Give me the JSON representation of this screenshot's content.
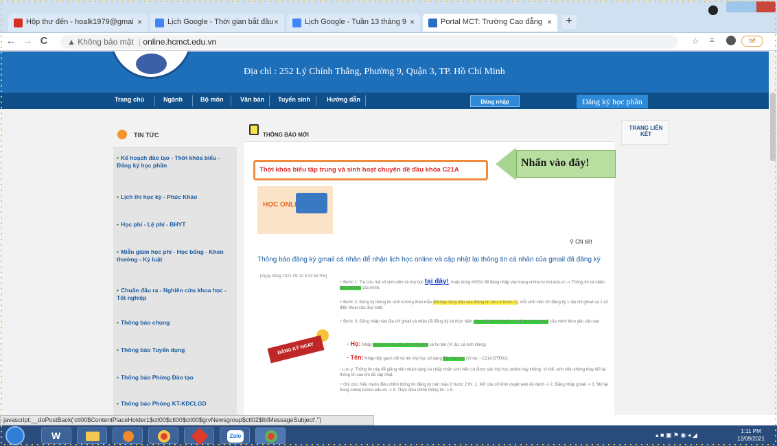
{
  "browser": {
    "tabs": [
      {
        "label": "Hộp thư đến - hoalk1979@gmai",
        "icon": "gmail-icon",
        "color": "#d93025"
      },
      {
        "label": "Lịch Google - Thời gian bắt đầu",
        "icon": "calendar-icon",
        "color": "#4285f4"
      },
      {
        "label": "Lịch Google - Tuần 13 tháng 9",
        "icon": "calendar-icon",
        "color": "#4285f4"
      },
      {
        "label": "Portal MCT: Trường Cao đẳng",
        "icon": "portal-icon",
        "color": "#2b6cc4"
      }
    ],
    "close_glyph": "×",
    "new_tab_glyph": "+",
    "back_glyph": "←",
    "forward_glyph": "→",
    "reload_glyph": "C",
    "security_text": "▲ Không bảo mật",
    "url": "online.hcmct.edu.vn",
    "profile_label": "tiế"
  },
  "site": {
    "address": "Địa chỉ : 252 Lý Chính Thắng, Phường 9, Quận 3, TP. Hồ Chí Minh",
    "menu": [
      "Trang chủ",
      "Ngành",
      "Bộ môn",
      "Văn bản",
      "Tuyển sinh",
      "Hướng dẫn"
    ],
    "login_label": "Đăng nhập",
    "register_label": "Đăng ký học phần"
  },
  "sidebar": {
    "title": "TIN TỨC",
    "items": [
      "Kế hoạch đào tạo - Thời khóa biểu - Đăng ký học phần",
      "Lịch thi học kỳ - Phúc Khảo",
      "Học phí - Lệ phí - BHYT",
      "Miễn giảm học phí - Học bổng - Khen thưởng - Kỷ luật",
      "Chuẩn đầu ra - Nghiên cứu khoa học - Tốt nghiệp",
      "Thông báo chung",
      "Thông báo Tuyển dụng",
      "Thông báo Phòng Đào tạo",
      "Thông báo Phòng KT-KĐCLGD"
    ]
  },
  "main": {
    "title": "THÔNG BÁO MỚI",
    "highlight": "Thời khóa biểu tập trung và sinh hoạt chuyên đề đầu khóa C21A",
    "callout": "Nhấn vào đây!",
    "image_text": "HỌC ONLINE",
    "detail_label": "CN tiết",
    "notice_title": "Thông báo đăng ký gmail cá nhân để nhận lịch học online và cập nhật lại thông tin cá nhân của gmail đã đăng ký",
    "notice_date": "[Ngày đăng:2021-09-10 8:43:54 PM]",
    "register_btn": "ĐĂNG KÝ NGAY",
    "step1_pre": "+ Bước 1: Tra cứu mã số sinh viên và lớp học",
    "step1_link": "tại đây!",
    "step1_post": "hoặc dùng MSSV để đăng nhập vào trang online.hcmct.edu.vn -> Thông tin cá nhân:",
    "step1_hl": "Mục thi học",
    "step1_end": "của mình.",
    "step2_pre": "+ Bước 2: Đăng ký thông tin sinh trường theo mẫu",
    "step2_hl": "(Không dùng dấu của thông tin như ở bước 3)",
    "step2_post": "mỗi sinh viên chỉ đăng ký 1 địa chỉ gmail và 1 số điện thoại của duy nhất.",
    "step3_pre": "+ Bước 3: Đăng nhập vào địa chỉ gmail và nhận đã đăng ký và thực hiện",
    "step3_hl": "cập nhật lại thông tin cá nhân trong gmail",
    "step3_post": "của mình theo yêu cầu sau:",
    "ho_label": "- Họ:",
    "ho_text": "Nhập",
    "ho_hl": "Mã sinh viên của sinh viên lớp",
    "ho_post": "và họ tên (Ví dụ: Lê Anh Hùng)",
    "ten_label": "- Tên:",
    "ten_text": "Nhập tiếp gạch nối và tên lớp học số dạng",
    "ten_hl": "Tên lớp học",
    "ten_post": "(Ví dụ: - C21A.ĐTĐ01)",
    "note1": "- Lưu ý: Thông tin này để giảng viên nhận dạng và chấp nhận sinh viên có được vào lớp học online hay không. Vì thế, sinh viên không thay đổi lại thông tin sau khi đã cập nhật.",
    "note2": "+ Ghi chú: Nếu muốn điều chỉnh thông tin đăng ký trên mẫu ở bước 2 thì: 1. Mở của sổ trình duyệt web ẩn danh -> 2. Đăng nhập gmail -> 3. Mở lại trang online.hcmct.edu.vn -> 4. Thực điều chỉnh thông tin -> 5."
  },
  "right_panel": {
    "title": "TRANG LIÊN KẾT"
  },
  "statusbar": "javascript:__doPostBack('ctl00$ContentPlaceHolder1$ctl00$ctl00$ctl00$grvNewsgroup$ctl02$lblMessageSubject','')",
  "taskbar": {
    "apps": [
      "windows-start-icon",
      "word-icon",
      "explorer-icon",
      "media-icon",
      "chrome-icon",
      "anydesk-icon",
      "zalo-icon",
      "chrome-icon"
    ],
    "zalo_label": "Zalo",
    "word_label": "W",
    "time": "1:11 PM",
    "date": "12/09/2021"
  }
}
